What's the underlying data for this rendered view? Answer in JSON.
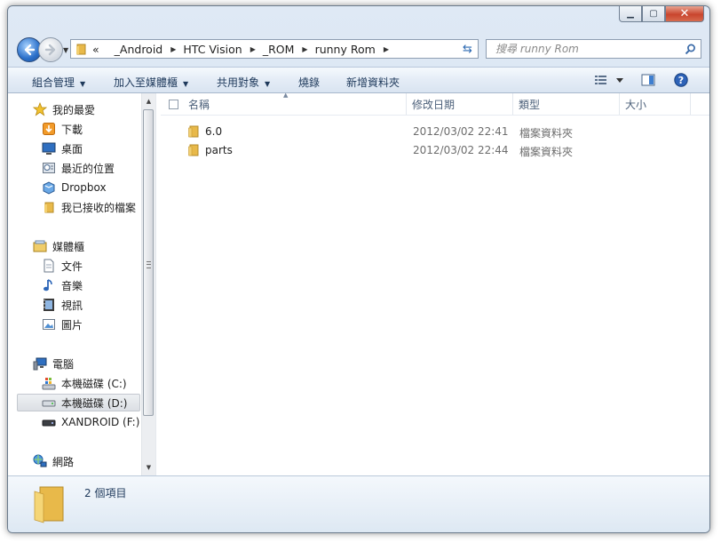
{
  "window": {
    "caption_buttons": {
      "minimize_icon": "minimize-icon",
      "maximize_icon": "maximize-icon",
      "close_icon": "close-icon"
    }
  },
  "address": {
    "overflow": "«",
    "crumbs": [
      "_Android",
      "HTC Vision",
      "_ROM",
      "runny Rom"
    ],
    "search_placeholder": "搜尋 runny Rom"
  },
  "toolbar": {
    "organize": "組合管理",
    "include": "加入至媒體櫃",
    "share": "共用對象",
    "burn": "燒錄",
    "new_folder": "新增資料夾"
  },
  "nav": {
    "favorites": "我的最愛",
    "downloads": "下載",
    "desktop": "桌面",
    "recent": "最近的位置",
    "dropbox": "Dropbox",
    "received": "我已接收的檔案",
    "libraries": "媒體櫃",
    "documents": "文件",
    "music": "音樂",
    "videos": "視訊",
    "pictures": "圖片",
    "computer": "電腦",
    "drive_c": "本機磁碟 (C:)",
    "drive_d": "本機磁碟 (D:)",
    "drive_f": "XANDROID (F:)",
    "network": "網路"
  },
  "columns": {
    "name": "名稱",
    "modified": "修改日期",
    "type": "類型",
    "size": "大小"
  },
  "files": [
    {
      "name": "6.0",
      "modified": "2012/03/02 22:41",
      "type": "檔案資料夾"
    },
    {
      "name": "parts",
      "modified": "2012/03/02 22:44",
      "type": "檔案資料夾"
    }
  ],
  "status": {
    "count": "2 個項目"
  },
  "colors": {
    "accent": "#2a6fc9",
    "folder": "#e8b94a",
    "toolbar_text": "#1e395b"
  }
}
